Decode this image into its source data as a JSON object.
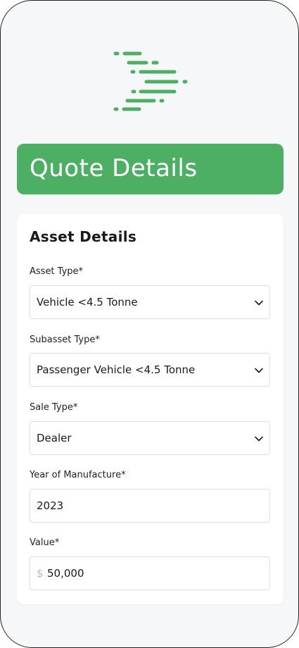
{
  "colors": {
    "brand_green": "#4caf63",
    "background": "#f6f7f9",
    "card": "#ffffff",
    "border": "#dcdfe3"
  },
  "header": {
    "logo_icon": "green-dash-arrow-logo",
    "title": "Quote Details"
  },
  "asset_details": {
    "title": "Asset Details",
    "fields": [
      {
        "label": "Asset Type*",
        "value": "Vehicle <4.5 Tonne",
        "control": "select",
        "icon": "chevron-down-icon"
      },
      {
        "label": "Subasset Type*",
        "value": "Passenger Vehicle <4.5 Tonne",
        "control": "select",
        "icon": "chevron-down-icon"
      },
      {
        "label": "Sale Type*",
        "value": "Dealer",
        "control": "select",
        "icon": "chevron-down-icon"
      },
      {
        "label": "Year of Manufacture*",
        "value": "2023",
        "control": "input"
      },
      {
        "label": "Value*",
        "prefix": "$",
        "value": "50,000",
        "control": "input"
      }
    ]
  }
}
